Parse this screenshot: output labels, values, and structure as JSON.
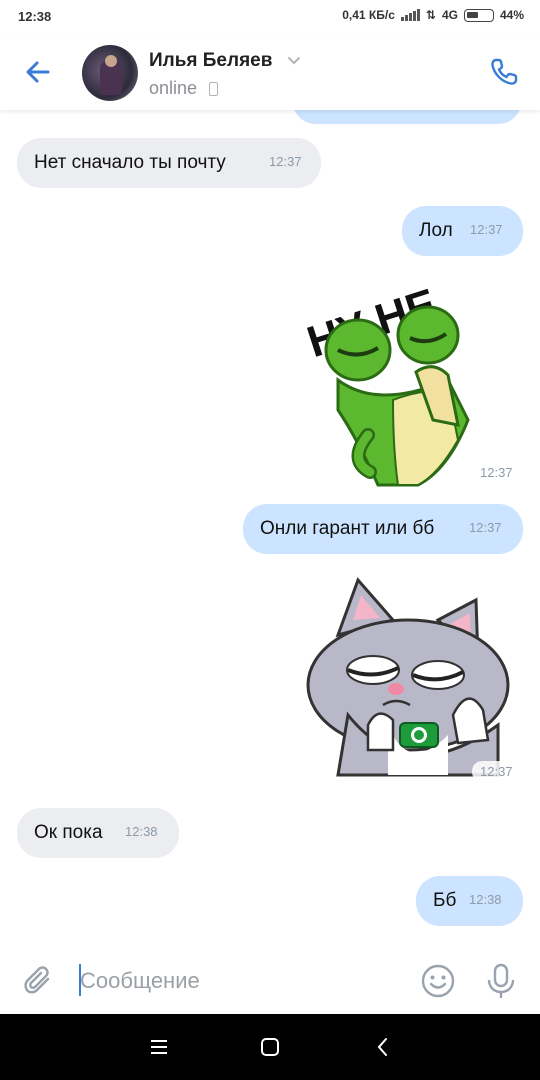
{
  "status_bar": {
    "time": "12:38",
    "speed": "0,41 КБ/с",
    "network": "4G",
    "battery": "44%"
  },
  "header": {
    "contact_name": "Илья Беляев",
    "contact_status": "online"
  },
  "messages": [
    {
      "direction": "in",
      "text": "Нет сначало ты почту",
      "time": "12:37"
    },
    {
      "direction": "out",
      "text": "Лол",
      "time": "12:37"
    },
    {
      "direction": "out",
      "type": "sticker",
      "sticker_text": "НУ НЕ",
      "time": "12:37"
    },
    {
      "direction": "out",
      "text": "Онли гарант или бб",
      "time": "12:37"
    },
    {
      "direction": "out",
      "type": "sticker",
      "time": "12:37"
    },
    {
      "direction": "in",
      "text": "Ок пока",
      "time": "12:38"
    },
    {
      "direction": "out",
      "text": "Бб",
      "time": "12:38"
    }
  ],
  "composer": {
    "placeholder": "Сообщение"
  },
  "colors": {
    "accent": "#3a7bd5",
    "incoming_bubble": "#ebedf0",
    "outgoing_bubble": "#cce4ff"
  },
  "icons": [
    "back-arrow-icon",
    "chevron-down-icon",
    "phone-icon",
    "paperclip-icon",
    "emoji-icon",
    "microphone-icon",
    "menu-icon",
    "home-icon",
    "nav-back-icon"
  ]
}
